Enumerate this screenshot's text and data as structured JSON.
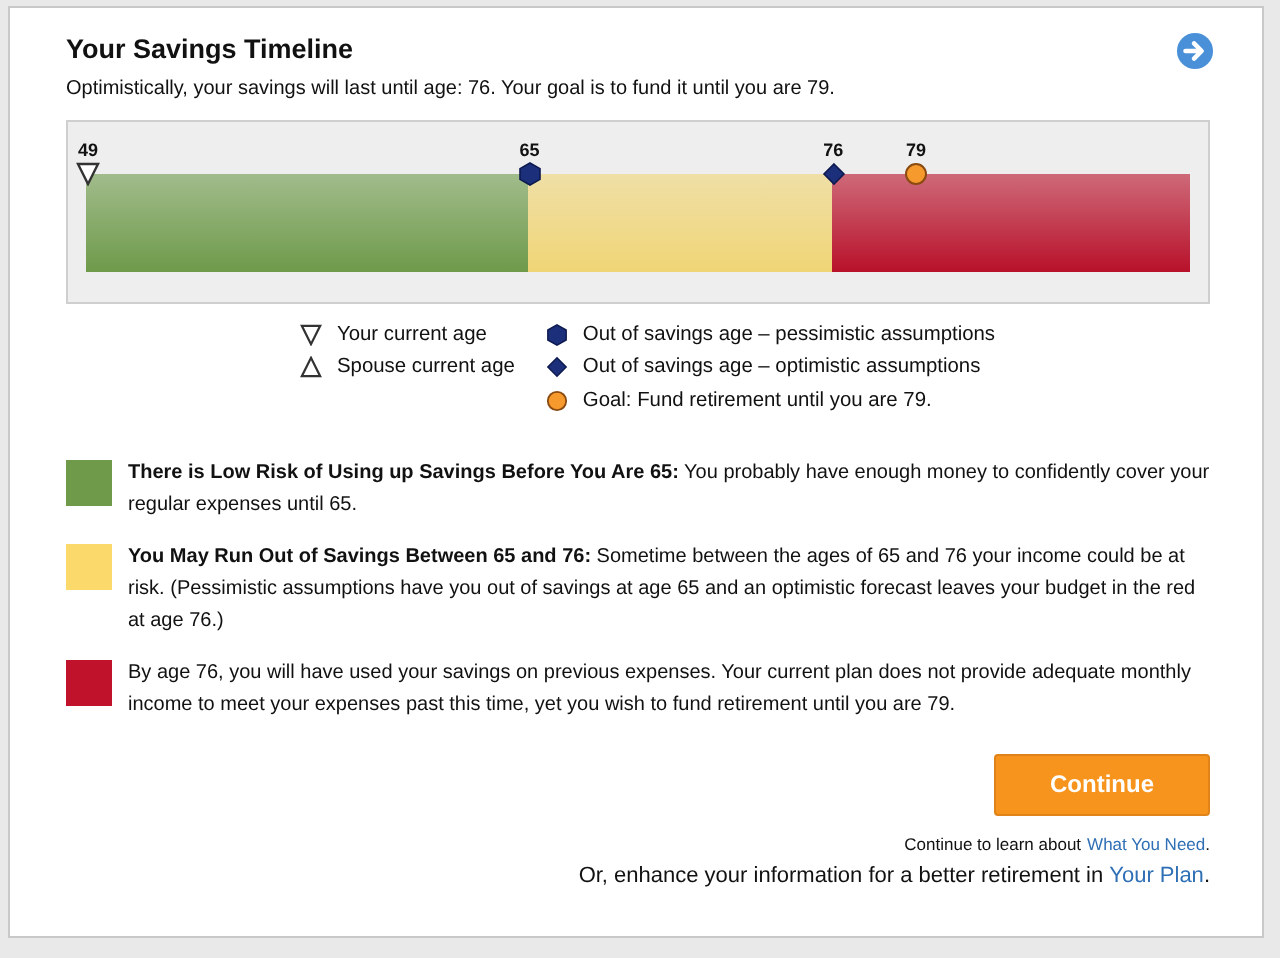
{
  "title": "Your Savings Timeline",
  "summary": "Optimistically, your savings will last until age: 76. Your goal is to fund it until you are 79.",
  "timeline": {
    "segments": [
      {
        "color": "#6e9a4a"
      },
      {
        "color": "#f0d576"
      },
      {
        "color": "#b8112a"
      }
    ],
    "markers": [
      {
        "label": "49",
        "kind": "down-triangle",
        "level": 0
      },
      {
        "label": "65",
        "kind": "hexagon",
        "level": 0.4
      },
      {
        "label": "76",
        "kind": "diamond",
        "level": 0.675
      },
      {
        "label": "79",
        "kind": "circle",
        "level": 0.75
      }
    ]
  },
  "legend": [
    [
      {
        "kind": "down-triangle",
        "text": "Your current age"
      },
      {
        "kind": "up-triangle",
        "text": "Spouse current age"
      }
    ],
    [
      {
        "kind": "hexagon",
        "text": "Out of savings age – pessimistic assumptions"
      },
      {
        "kind": "diamond",
        "text": "Out of savings age – optimistic assumptions"
      },
      {
        "kind": "circle",
        "text": "Goal: Fund retirement until you are 79."
      }
    ]
  ],
  "risks": [
    {
      "color": "#6e9a4a",
      "text": "**There is Low Risk of Using up Savings Before You Are 65:** You probably have enough money to confidently cover your regular expenses until 65."
    },
    {
      "color": "#fbd96b",
      "text": "**You May Run Out of Savings Between 65 and 76:** Sometime between the ages of 65 and 76 your income could be at risk. (Pessimistic assumptions have you out of savings at age 65 and an optimistic forecast leaves your budget in the red at age 76.)"
    },
    {
      "color": "#c0132b",
      "text": "By age 76, you will have used your savings on previous expenses. Your current plan does not provide adequate monthly income to meet your expenses past this time, yet you wish to fund retirement until you are 79."
    }
  ],
  "continue_button": "Continue",
  "learn_text": "Continue to learn about",
  "learn_link": "What You Need",
  "learn_end": ".",
  "plan_text": "Or, enhance your information for a better retirement in",
  "plan_link": "Your Plan",
  "plan_end": "."
}
